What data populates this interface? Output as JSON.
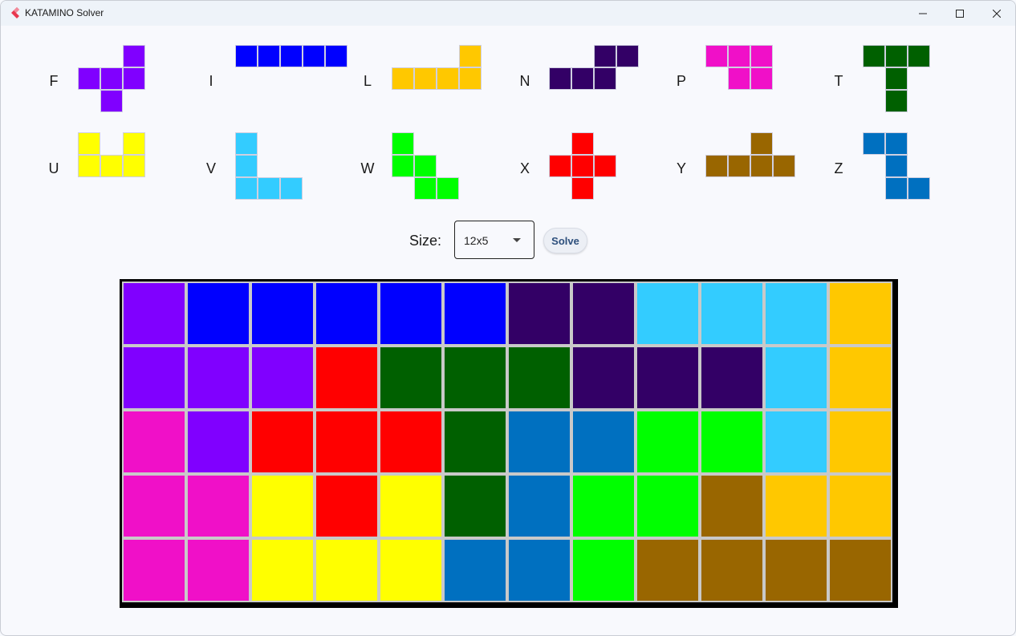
{
  "window": {
    "title": "KATAMINO Solver",
    "controls": {
      "minimize": "—",
      "maximize": "☐",
      "close": "✕"
    }
  },
  "colors": {
    "F": "#8000ff",
    "I": "#0000ff",
    "L": "#ffc800",
    "N": "#330066",
    "P": "#f010c8",
    "T": "#006000",
    "U": "#ffff00",
    "V": "#33ccff",
    "W": "#00ff00",
    "X": "#ff0000",
    "Y": "#996600",
    "Z": "#0070c0"
  },
  "pieces": [
    {
      "name": "F",
      "cells": [
        [
          2,
          0
        ],
        [
          0,
          1
        ],
        [
          1,
          1
        ],
        [
          2,
          1
        ],
        [
          1,
          2
        ]
      ]
    },
    {
      "name": "I",
      "cells": [
        [
          0,
          0
        ],
        [
          1,
          0
        ],
        [
          2,
          0
        ],
        [
          3,
          0
        ],
        [
          4,
          0
        ]
      ]
    },
    {
      "name": "L",
      "cells": [
        [
          3,
          0
        ],
        [
          0,
          1
        ],
        [
          1,
          1
        ],
        [
          2,
          1
        ],
        [
          3,
          1
        ]
      ]
    },
    {
      "name": "N",
      "cells": [
        [
          2,
          0
        ],
        [
          3,
          0
        ],
        [
          0,
          1
        ],
        [
          1,
          1
        ],
        [
          2,
          1
        ]
      ]
    },
    {
      "name": "P",
      "cells": [
        [
          0,
          0
        ],
        [
          1,
          0
        ],
        [
          2,
          0
        ],
        [
          1,
          1
        ],
        [
          2,
          1
        ]
      ]
    },
    {
      "name": "T",
      "cells": [
        [
          0,
          0
        ],
        [
          1,
          0
        ],
        [
          2,
          0
        ],
        [
          1,
          1
        ],
        [
          1,
          2
        ]
      ]
    },
    {
      "name": "U",
      "cells": [
        [
          0,
          0
        ],
        [
          2,
          0
        ],
        [
          0,
          1
        ],
        [
          1,
          1
        ],
        [
          2,
          1
        ]
      ]
    },
    {
      "name": "V",
      "cells": [
        [
          0,
          0
        ],
        [
          0,
          1
        ],
        [
          0,
          2
        ],
        [
          1,
          2
        ],
        [
          2,
          2
        ]
      ]
    },
    {
      "name": "W",
      "cells": [
        [
          0,
          0
        ],
        [
          0,
          1
        ],
        [
          1,
          1
        ],
        [
          1,
          2
        ],
        [
          2,
          2
        ]
      ]
    },
    {
      "name": "X",
      "cells": [
        [
          1,
          0
        ],
        [
          0,
          1
        ],
        [
          1,
          1
        ],
        [
          2,
          1
        ],
        [
          1,
          2
        ]
      ]
    },
    {
      "name": "Y",
      "cells": [
        [
          2,
          0
        ],
        [
          0,
          1
        ],
        [
          1,
          1
        ],
        [
          2,
          1
        ],
        [
          3,
          1
        ]
      ]
    },
    {
      "name": "Z",
      "cells": [
        [
          0,
          0
        ],
        [
          1,
          0
        ],
        [
          1,
          1
        ],
        [
          1,
          2
        ],
        [
          2,
          2
        ]
      ]
    }
  ],
  "controls": {
    "size_label": "Size:",
    "size_value": "12x5",
    "solve_label": "Solve"
  },
  "board": {
    "cols": 12,
    "rows": 5,
    "grid": [
      [
        "F",
        "I",
        "I",
        "I",
        "I",
        "I",
        "N",
        "N",
        "V",
        "V",
        "V",
        "L"
      ],
      [
        "F",
        "F",
        "F",
        "X",
        "T",
        "T",
        "T",
        "N",
        "N",
        "N",
        "V",
        "L"
      ],
      [
        "P",
        "F",
        "X",
        "X",
        "X",
        "T",
        "Z",
        "Z",
        "W",
        "W",
        "V",
        "L"
      ],
      [
        "P",
        "P",
        "U",
        "X",
        "U",
        "T",
        "Z",
        "W",
        "W",
        "Y",
        "L",
        "L"
      ],
      [
        "P",
        "P",
        "U",
        "U",
        "U",
        "Z",
        "Z",
        "W",
        "Y",
        "Y",
        "Y",
        "Y"
      ]
    ]
  }
}
